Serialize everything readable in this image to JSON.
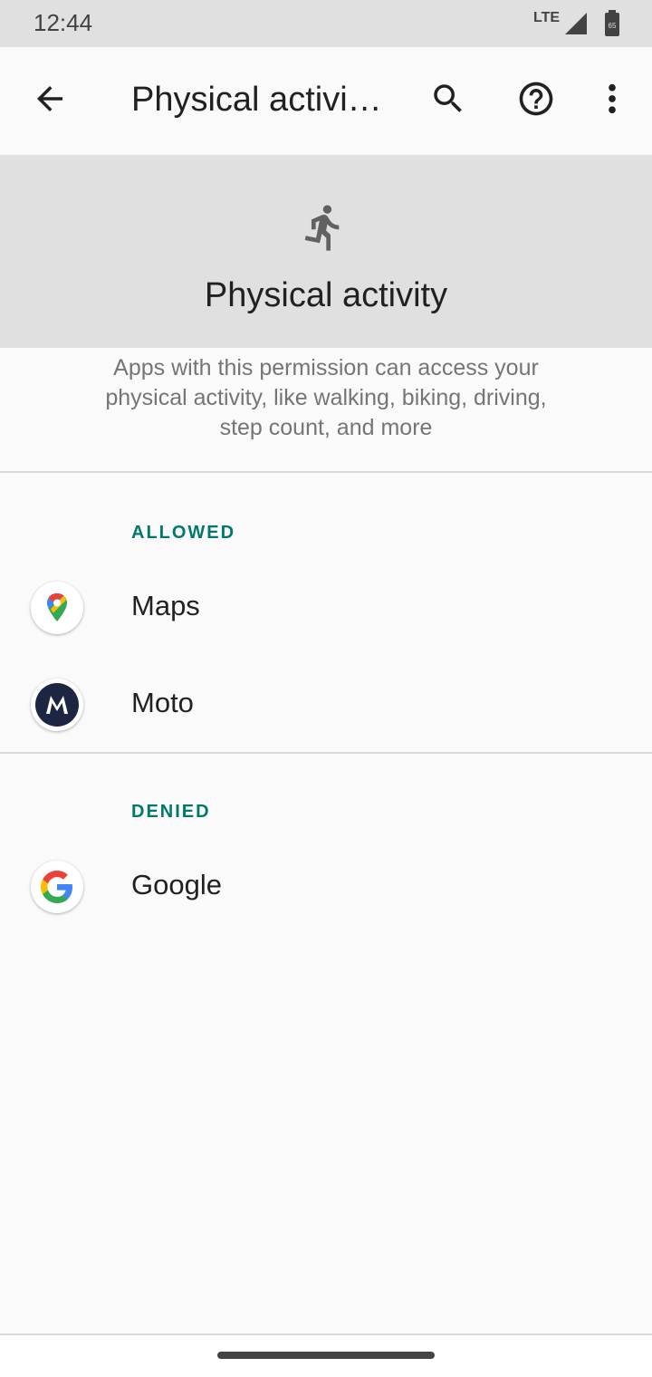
{
  "status_bar": {
    "time": "12:44",
    "network": "LTE",
    "battery_level": "65"
  },
  "app_bar": {
    "title": "Physical activi…",
    "icons": [
      "back-arrow-icon",
      "search-icon",
      "help-icon",
      "more-vert-icon"
    ]
  },
  "hero": {
    "icon": "running-person-icon",
    "title": "Physical activity"
  },
  "description": "Apps with this permission can access your physical activity, like walking, biking, driving, step count, and more",
  "sections": {
    "allowed": {
      "header": "ALLOWED",
      "apps": [
        {
          "name": "Maps",
          "icon": "google-maps-icon"
        },
        {
          "name": "Moto",
          "icon": "motorola-icon"
        }
      ]
    },
    "denied": {
      "header": "DENIED",
      "apps": [
        {
          "name": "Google",
          "icon": "google-g-icon"
        }
      ]
    }
  },
  "colors": {
    "accent": "#00796b",
    "header_bg": "#e0e0e0",
    "background": "#fafafa"
  }
}
